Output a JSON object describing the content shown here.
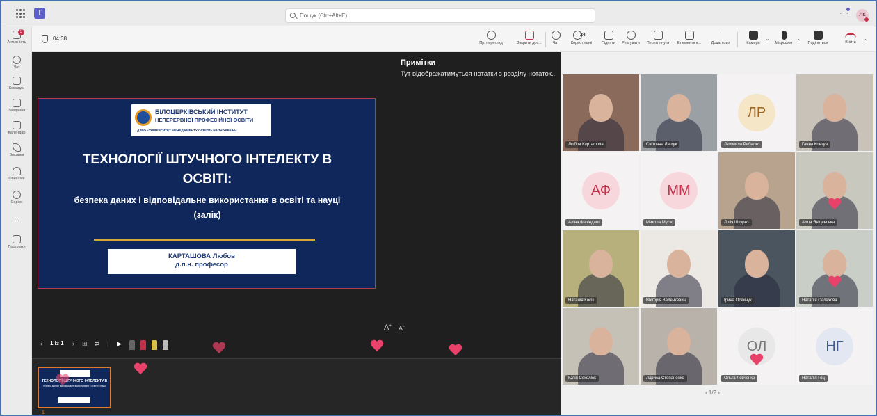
{
  "topbar": {
    "search_placeholder": "Пошук (Ctrl+Alt+E)",
    "avatar_initials": "ЛК"
  },
  "rail": [
    {
      "label": "Активність",
      "badge": "3"
    },
    {
      "label": "Чат"
    },
    {
      "label": "Команди"
    },
    {
      "label": "Завдання"
    },
    {
      "label": "Календар"
    },
    {
      "label": "Виклики"
    },
    {
      "label": "OneDrive"
    },
    {
      "label": "Copilot"
    },
    {
      "label": "..."
    },
    {
      "label": "Програми"
    }
  ],
  "meeting": {
    "timer": "04:38",
    "tools": {
      "preview": "Пр. перегляд",
      "close": "Закрити дос...",
      "chat": "Чат",
      "people": "Користувачі",
      "people_count": "24",
      "raise": "Підняти",
      "react": "Реагувати",
      "view": "Переглянути",
      "elements": "Елементи к...",
      "more": "Додатково",
      "camera": "Камера",
      "mic": "Мікрофон",
      "share": "Поділитися",
      "leave": "Вийти"
    }
  },
  "slide": {
    "logo_line1": "БІЛОЦЕРКІВСЬКИЙ ІНСТИТУТ",
    "logo_line2": "НЕПЕРЕРВНОЇ ПРОФЕСІЙНОЇ ОСВІТИ",
    "logo_line3": "ДЗВО «УНІВЕРСИТЕТ МЕНЕДЖМЕНТУ ОСВІТИ» НАПН УКРАЇНИ",
    "title_line1": "ТЕХНОЛОГІЇ ШТУЧНОГО ІНТЕЛЕКТУ В",
    "title_line2": "ОСВІТІ:",
    "subtitle_line1": "безпека даних і відповідальне використання в освіті та науці",
    "subtitle_line2": "(залік)",
    "author": "КАРТАШОВА Любов",
    "degree": "д.п.н. професор"
  },
  "notes": {
    "title": "Примітки",
    "text": "Тут відображатимуться нотатки з розділу нотаток..."
  },
  "slide_controls": {
    "page": "1 із 1",
    "thumb_number": "1"
  },
  "participants": [
    {
      "name": "Любов Карташова",
      "initials": "",
      "color": "#8a6a5a"
    },
    {
      "name": "Світлана Ляшук",
      "initials": "",
      "color": "#9aa0a4"
    },
    {
      "name": "Людмила Рибалко",
      "initials": "ЛР",
      "color": "#f6e6c8",
      "text_color": "#a0651e"
    },
    {
      "name": "Ганна Ковтун",
      "initials": "",
      "color": "#c9c2b8"
    },
    {
      "name": "Аліна Феліндаш",
      "initials": "АФ",
      "color": "#f8d7dc",
      "text_color": "#c4314b"
    },
    {
      "name": "Микола Мусік",
      "initials": "ММ",
      "color": "#f8d7dc",
      "text_color": "#c4314b"
    },
    {
      "name": "Лілія Шкурко",
      "initials": "",
      "color": "#b8a48e"
    },
    {
      "name": "Алла Яніцевська",
      "initials": "",
      "color": "#c9c8be"
    },
    {
      "name": "Наталія Косік",
      "initials": "",
      "color": "#b7b07c"
    },
    {
      "name": "Вікторія Валенкевич",
      "initials": "",
      "color": "#ece8e4"
    },
    {
      "name": "Ірина Осейчук",
      "initials": "",
      "color": "#4a5560"
    },
    {
      "name": "Наталія Салахова",
      "initials": "",
      "color": "#c9cfc7"
    },
    {
      "name": "Юлія Соколюк",
      "initials": "",
      "color": "#c6c1b7"
    },
    {
      "name": "Лариса Степаненко",
      "initials": "",
      "color": "#b8b2ab"
    },
    {
      "name": "Ольга Левченко",
      "initials": "ОЛ",
      "color": "#e8e8e8",
      "text_color": "#777"
    },
    {
      "name": "Наталія Гоц",
      "initials": "НГ",
      "color": "#e3e7f2",
      "text_color": "#3f5a8a"
    }
  ],
  "pager": "1/2"
}
